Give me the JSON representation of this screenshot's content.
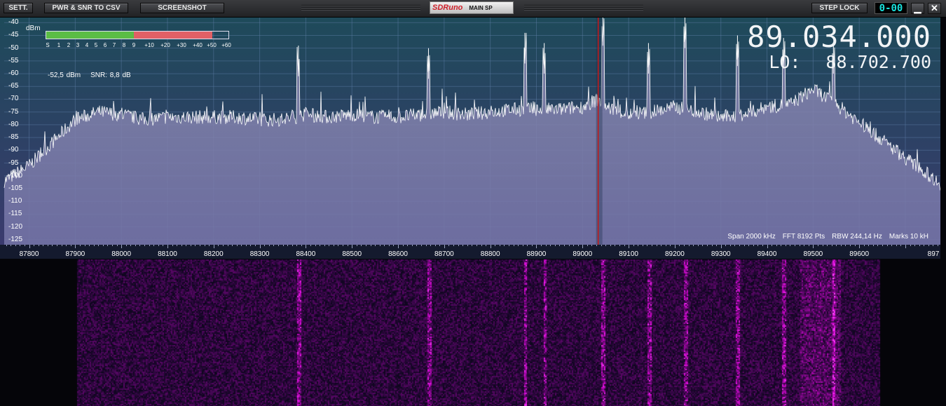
{
  "toolbar": {
    "settings_label": "SETT.",
    "pwr_snr_label": "PWR & SNR TO CSV",
    "screenshot_label": "SCREENSHOT",
    "app_logo": "SDRuno",
    "mode_label": "MAIN SP",
    "step_lock_label": "STEP LOCK",
    "digital_display": "0-00",
    "minimize_icon": "minimize-icon",
    "close_icon": "close-icon"
  },
  "spectrum": {
    "unit_label": "dBm",
    "y_ticks": [
      "-40",
      "-45",
      "-50",
      "-55",
      "-60",
      "-65",
      "-70",
      "-75",
      "-80",
      "-85",
      "-90",
      "-95",
      "-100",
      "-105",
      "-110",
      "-115",
      "-120",
      "-125"
    ],
    "x_ticks": [
      "87800",
      "87900",
      "88000",
      "88100",
      "88200",
      "88300",
      "88400",
      "88500",
      "88600",
      "88700",
      "88800",
      "88900",
      "89000",
      "89100",
      "89200",
      "89300",
      "89400",
      "89500",
      "89600",
      "897"
    ],
    "smeter_labels": [
      "S",
      "1",
      "2",
      "3",
      "4",
      "5",
      "6",
      "7",
      "8",
      "9",
      "+10",
      "+20",
      "+30",
      "+40",
      "+50",
      "+60"
    ],
    "power_level": "-52,5 dBm",
    "snr": "SNR: 8,8 dB",
    "frequency": "89.034.000",
    "lo_label": "LO:",
    "lo_frequency": "88.702.700",
    "span": "Span 2000 kHz",
    "fft": "FFT 8192 Pts",
    "rbw": "RBW 244,14 Hz",
    "marks": "Marks 10 kH",
    "smeter_fraction": 0.91,
    "tuned_frequency_khz": 89034
  },
  "chart_data": {
    "type": "area",
    "xlabel": "",
    "ylabel": "dBm",
    "xlim": [
      87746,
      89776
    ],
    "ylim": [
      -127,
      -38
    ],
    "x": [
      87746,
      87800,
      87850,
      87900,
      87950,
      88000,
      88050,
      88100,
      88150,
      88200,
      88250,
      88300,
      88350,
      88400,
      88450,
      88500,
      88550,
      88600,
      88650,
      88700,
      88750,
      88800,
      88850,
      88900,
      88950,
      89000,
      89034,
      89050,
      89100,
      89150,
      89200,
      89250,
      89300,
      89350,
      89400,
      89450,
      89500,
      89550,
      89600,
      89650,
      89700,
      89776
    ],
    "y": [
      -102,
      -96,
      -87,
      -78,
      -75,
      -76,
      -78,
      -77,
      -77,
      -77,
      -77,
      -78,
      -78,
      -76,
      -77,
      -76,
      -77,
      -77,
      -76,
      -75,
      -76,
      -75,
      -74,
      -74,
      -74,
      -73,
      -70,
      -73,
      -76,
      -75,
      -73,
      -75,
      -77,
      -76,
      -73,
      -72,
      -66,
      -72,
      -79,
      -86,
      -93,
      -103
    ],
    "peaks": [
      {
        "x": 88384,
        "y": -61
      },
      {
        "x": 88666,
        "y": -62
      },
      {
        "x": 88875,
        "y": -56
      },
      {
        "x": 88917,
        "y": -60
      },
      {
        "x": 89044,
        "y": -49
      },
      {
        "x": 89143,
        "y": -60
      },
      {
        "x": 89222,
        "y": -50
      },
      {
        "x": 89336,
        "y": -57
      },
      {
        "x": 89436,
        "y": -58
      },
      {
        "x": 89544,
        "y": -60
      }
    ]
  },
  "colors": {
    "panel_top": "#1e4a5a",
    "panel_bottom": "#3a3a6e",
    "fill": "#8a8ab0",
    "trace": "#ffffff",
    "center_line": "#c61818",
    "smeter_green": "#5bbd45",
    "smeter_red": "#e16066"
  }
}
